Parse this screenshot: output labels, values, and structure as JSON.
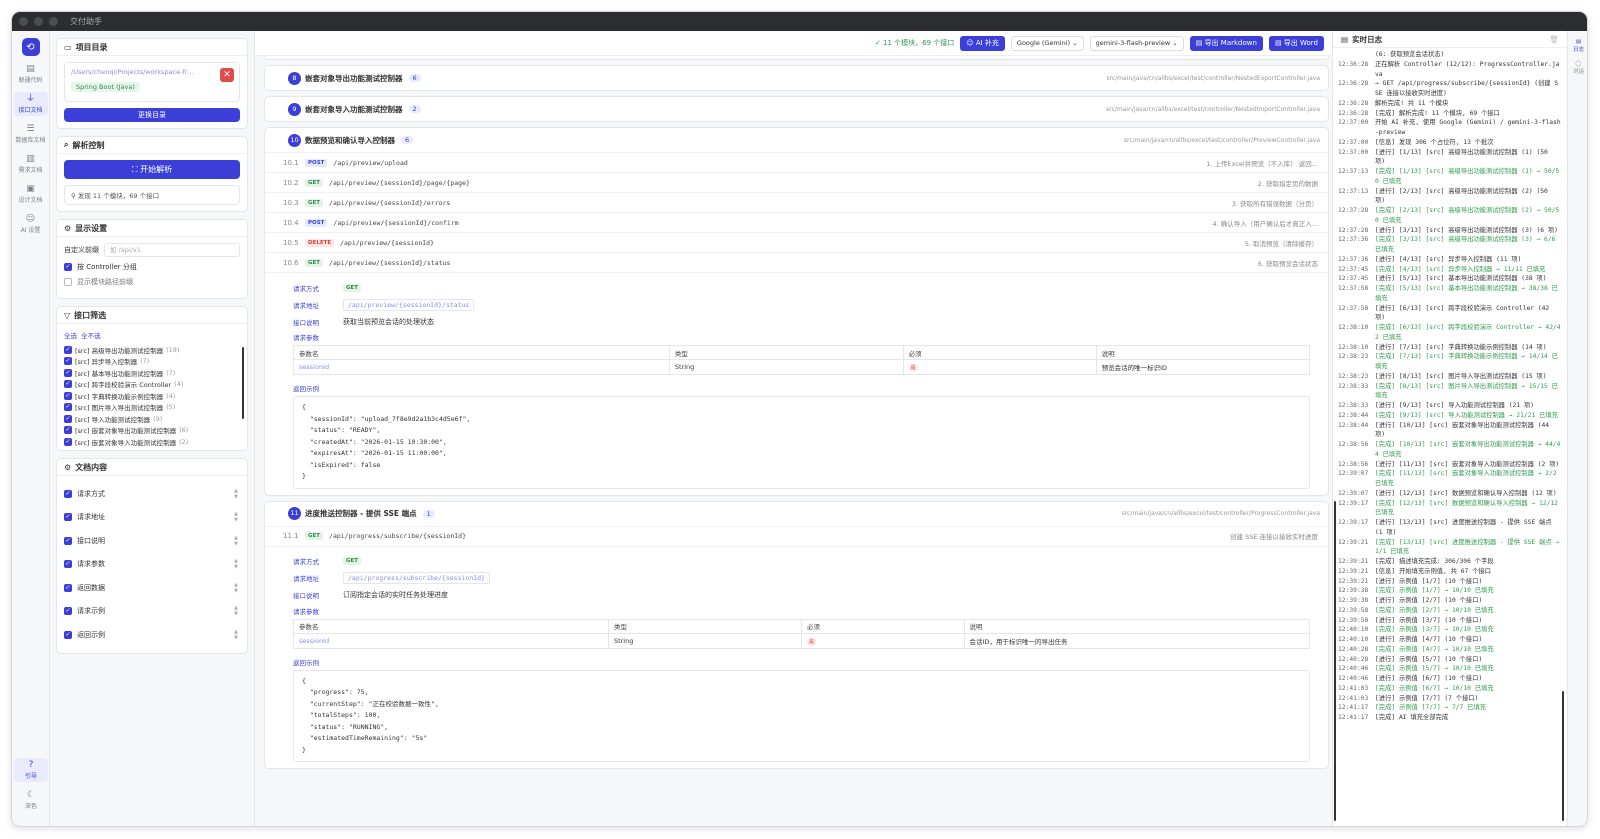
{
  "window": {
    "title": "交付助手"
  },
  "rail": {
    "items": [
      {
        "label": "联通代码",
        "icon": "code-file-icon"
      },
      {
        "label": "接口文档",
        "icon": "plug-icon",
        "active": true
      },
      {
        "label": "数据库文档",
        "icon": "database-icon"
      },
      {
        "label": "需求文档",
        "icon": "book-icon"
      },
      {
        "label": "设计文档",
        "icon": "doc-icon"
      },
      {
        "label": "AI 设置",
        "icon": "robot-icon"
      }
    ],
    "help": "引导",
    "theme": "深色"
  },
  "project": {
    "title": "项目目录",
    "path": "/Users/chenqi/Projects/workspace-fr…",
    "framework": "Spring Boot (Java)",
    "change_btn": "更换目录"
  },
  "parse": {
    "title": "解析控制",
    "start_btn": "开始解析",
    "summary": "发现 11 个模块，69 个接口"
  },
  "display": {
    "title": "显示设置",
    "prefix_label": "自定义前缀",
    "prefix_placeholder": "如 /api/v1",
    "group_by_controller": "按 Controller 分组",
    "show_module_prefix": "显示模块路径前缀"
  },
  "filter": {
    "title": "接口筛选",
    "select_all": "全选",
    "select_none": "全不选",
    "items": [
      {
        "label": "[src] 高级导出功能测试控制器",
        "n": "(18)"
      },
      {
        "label": "[src] 异步导入控制器",
        "n": "(7)"
      },
      {
        "label": "[src] 基本导出功能测试控制器",
        "n": "(7)"
      },
      {
        "label": "[src] 跨字段校验演示 Controller",
        "n": "(4)"
      },
      {
        "label": "[src] 字典转换功能示例控制器",
        "n": "(4)"
      },
      {
        "label": "[src] 图片导入导出测试控制器",
        "n": "(5)"
      },
      {
        "label": "[src] 导入功能测试控制器",
        "n": "(9)"
      },
      {
        "label": "[src] 嵌套对象导出功能测试控制器",
        "n": "(6)"
      },
      {
        "label": "[src] 嵌套对象导入功能测试控制器",
        "n": "(2)"
      }
    ]
  },
  "doc_content": {
    "title": "文档内容",
    "items": [
      "请求方式",
      "请求地址",
      "接口说明",
      "请求参数",
      "返回数据",
      "请求示例",
      "返回示例"
    ]
  },
  "toolbar": {
    "status": "✓ 11 个模块，69 个接口",
    "ai_btn": "AI 补充",
    "provider": "Google (Gemini)",
    "model": "gemini-3-flash-preview",
    "export_md": "导出 Markdown",
    "export_word": "导出 Word"
  },
  "groups": [
    {
      "num": "8",
      "title": "嵌套对象导出功能测试控制器",
      "count": "6",
      "path": "src/main/java/cn/allbs/excel/test/controller/NestedExportController.java"
    },
    {
      "num": "9",
      "title": "嵌套对象导入功能测试控制器",
      "count": "2",
      "path": "src/main/java/cn/allbs/excel/test/controller/NestedImportController.java"
    },
    {
      "num": "10",
      "title": "数据预览和确认导入控制器",
      "count": "6",
      "path": "src/main/java/cn/allbs/excel/test/controller/PreviewController.java",
      "endpoints": [
        {
          "no": "10.1",
          "method": "POST",
          "url": "/api/preview/upload",
          "desc": "1. 上传Excel并预览（不入库） 返回..."
        },
        {
          "no": "10.2",
          "method": "GET",
          "url": "/api/preview/{sessionId}/page/{page}",
          "desc": "2. 获取指定页的数据"
        },
        {
          "no": "10.3",
          "method": "GET",
          "url": "/api/preview/{sessionId}/errors",
          "desc": "3. 获取所有错误数据（分页）"
        },
        {
          "no": "10.4",
          "method": "POST",
          "url": "/api/preview/{sessionId}/confirm",
          "desc": "4. 确认导入（用户确认后才真正入..."
        },
        {
          "no": "10.5",
          "method": "DELETE",
          "url": "/api/preview/{sessionId}",
          "desc": "5. 取消预览（清除缓存）"
        },
        {
          "no": "10.6",
          "method": "GET",
          "url": "/api/preview/{sessionId}/status",
          "desc": "6. 获取预览会话状态"
        }
      ],
      "detail": {
        "method_label": "请求方式",
        "method": "GET",
        "url_label": "请求地址",
        "url": "/api/preview/{sessionId}/status",
        "desc_label": "接口说明",
        "desc": "获取当前预览会话的处理状态",
        "params_label": "请求参数",
        "cols": [
          "参数名",
          "类型",
          "必须",
          "说明"
        ],
        "params": [
          {
            "name": "sessionId",
            "type": "String",
            "req": "是",
            "desc": "预览会话的唯一标识ID"
          }
        ],
        "return_label": "返回示例",
        "code": "{\n  \"sessionId\": \"upload_7f8e9d2a1b3c4d5e6f\",\n  \"status\": \"READY\",\n  \"createdAt\": \"2026-01-15 10:30:00\",\n  \"expiresAt\": \"2026-01-15 11:00:00\",\n  \"isExpired\": false\n}"
      }
    },
    {
      "num": "11",
      "title": "进度推送控制器 - 提供 SSE 端点",
      "count": "1",
      "path": "src/main/java/cn/allbs/excel/test/controller/ProgressController.java",
      "endpoints": [
        {
          "no": "11.1",
          "method": "GET",
          "url": "/api/progress/subscribe/{sessionId}",
          "desc": "创建 SSE 连接以接收实时进度"
        }
      ],
      "detail": {
        "method_label": "请求方式",
        "method": "GET",
        "url_label": "请求地址",
        "url": "/api/progress/subscribe/{sessionId}",
        "desc_label": "接口说明",
        "desc": "订阅指定会话的实时任务处理进度",
        "params_label": "请求参数",
        "cols": [
          "参数名",
          "类型",
          "必须",
          "说明"
        ],
        "params": [
          {
            "name": "sessionId",
            "type": "String",
            "req": "是",
            "desc": "会话ID，用于标识唯一的导出任务"
          }
        ],
        "return_label": "返回示例",
        "code": "{\n  \"progress\": 75,\n  \"currentStep\": \"正在校验数据一致性\",\n  \"totalSteps\": 100,\n  \"status\": \"RUNNING\",\n  \"estimatedTimeRemaining\": \"5s\"\n}"
      }
    }
  ],
  "log": {
    "title": "实时日志",
    "lines": [
      {
        "t": "",
        "x": "(6: 获取预览会话状态)",
        "g": 0
      },
      {
        "t": "12:36:28",
        "x": "正在解析 Controller (12/12): ProgressController.java",
        "g": 0
      },
      {
        "t": "12:36:28",
        "x": "→ GET /api/progress/subscribe/{sessionId} (创建 SSE 连接以接收实时进度)",
        "g": 0
      },
      {
        "t": "12:36:28",
        "x": "解析完成! 共 11 个模块",
        "g": 0
      },
      {
        "t": "12:36:28",
        "x": "[完成] 解析完成! 11 个模块, 69 个接口",
        "g": 0
      },
      {
        "t": "12:37:00",
        "x": "开始 AI 补充, 使用 Google (Gemini) / gemini-3-flash-preview",
        "g": 0
      },
      {
        "t": "12:37:00",
        "x": "[信息] 发现 306 个占位符, 13 个批次",
        "g": 0
      },
      {
        "t": "12:37:00",
        "x": "[进行] [1/13] [src] 高级导出功能测试控制器 (1) (50 项)",
        "g": 0
      },
      {
        "t": "12:37:13",
        "x": "[完成] [1/13] [src] 高级导出功能测试控制器 (1) → 50/50 已填充",
        "g": 1
      },
      {
        "t": "12:37:13",
        "x": "[进行] [2/13] [src] 高级导出功能测试控制器 (2) (50 项)",
        "g": 0
      },
      {
        "t": "12:37:28",
        "x": "[完成] [2/13] [src] 高级导出功能测试控制器 (2) → 50/50 已填充",
        "g": 1
      },
      {
        "t": "12:37:28",
        "x": "[进行] [3/13] [src] 高级导出功能测试控制器 (3) (6 项)",
        "g": 0
      },
      {
        "t": "12:37:36",
        "x": "[完成] [3/13] [src] 高级导出功能测试控制器 (3) → 6/6 已填充",
        "g": 1
      },
      {
        "t": "12:37:36",
        "x": "[进行] [4/13] [src] 异步导入控制器 (11 项)",
        "g": 0
      },
      {
        "t": "12:37:45",
        "x": "[完成] [4/13] [src] 异步导入控制器 → 11/11 已填充",
        "g": 1
      },
      {
        "t": "12:37:45",
        "x": "[进行] [5/13] [src] 基本导出功能测试控制器 (38 项)",
        "g": 0
      },
      {
        "t": "12:37:58",
        "x": "[完成] [5/13] [src] 基本导出功能测试控制器 → 38/38 已填充",
        "g": 1
      },
      {
        "t": "12:37:58",
        "x": "[进行] [6/13] [src] 跨字段校验演示 Controller (42 项)",
        "g": 0
      },
      {
        "t": "12:38:10",
        "x": "[完成] [6/13] [src] 跨字段校验演示 Controller → 42/42 已填充",
        "g": 1
      },
      {
        "t": "12:38:10",
        "x": "[进行] [7/13] [src] 字典转换功能示例控制器 (14 项)",
        "g": 0
      },
      {
        "t": "12:38:23",
        "x": "[完成] [7/13] [src] 字典转换功能示例控制器 → 14/14 已填充",
        "g": 1
      },
      {
        "t": "12:38:23",
        "x": "[进行] [8/13] [src] 图片导入导出测试控制器 (15 项)",
        "g": 0
      },
      {
        "t": "12:38:33",
        "x": "[完成] [8/13] [src] 图片导入导出测试控制器 → 15/15 已填充",
        "g": 1
      },
      {
        "t": "12:38:33",
        "x": "[进行] [9/13] [src] 导入功能测试控制器 (21 项)",
        "g": 0
      },
      {
        "t": "12:38:44",
        "x": "[完成] [9/13] [src] 导入功能测试控制器 → 21/21 已填充",
        "g": 1
      },
      {
        "t": "12:38:44",
        "x": "[进行] [10/13] [src] 嵌套对象导出功能测试控制器 (44 项)",
        "g": 0
      },
      {
        "t": "12:38:56",
        "x": "[完成] [10/13] [src] 嵌套对象导出功能测试控制器 → 44/44 已填充",
        "g": 1
      },
      {
        "t": "12:38:56",
        "x": "[进行] [11/13] [src] 嵌套对象导入功能测试控制器 (2 项)",
        "g": 0
      },
      {
        "t": "12:39:07",
        "x": "[完成] [11/13] [src] 嵌套对象导入功能测试控制器 → 2/2 已填充",
        "g": 1
      },
      {
        "t": "12:39:07",
        "x": "[进行] [12/13] [src] 数据预览和确认导入控制器 (12 项)",
        "g": 0
      },
      {
        "t": "12:39:17",
        "x": "[完成] [12/13] [src] 数据预览和确认导入控制器 → 12/12 已填充",
        "g": 1
      },
      {
        "t": "12:39:17",
        "x": "[进行] [13/13] [src] 进度推送控制器 - 提供 SSE 端点 (1 项)",
        "g": 0
      },
      {
        "t": "12:39:21",
        "x": "[完成] [13/13] [src] 进度推送控制器 - 提供 SSE 端点 → 1/1 已填充",
        "g": 1
      },
      {
        "t": "12:39:21",
        "x": "[完成] 描述填充完成: 306/306 个字段",
        "g": 0
      },
      {
        "t": "12:39:21",
        "x": "[信息] 开始填充示例值, 共 67 个接口",
        "g": 0
      },
      {
        "t": "12:39:21",
        "x": "[进行] 示例值 [1/7] (10 个接口)",
        "g": 0
      },
      {
        "t": "12:39:38",
        "x": "[完成] 示例值 [1/7] → 10/10 已填充",
        "g": 1
      },
      {
        "t": "12:39:38",
        "x": "[进行] 示例值 [2/7] (10 个接口)",
        "g": 0
      },
      {
        "t": "12:39:58",
        "x": "[完成] 示例值 [2/7] → 10/10 已填充",
        "g": 1
      },
      {
        "t": "12:39:58",
        "x": "[进行] 示例值 [3/7] (10 个接口)",
        "g": 0
      },
      {
        "t": "12:40:10",
        "x": "[完成] 示例值 [3/7] → 10/10 已填充",
        "g": 1
      },
      {
        "t": "12:40:10",
        "x": "[进行] 示例值 [4/7] (10 个接口)",
        "g": 0
      },
      {
        "t": "12:40:28",
        "x": "[完成] 示例值 [4/7] → 10/10 已填充",
        "g": 1
      },
      {
        "t": "12:40:28",
        "x": "[进行] 示例值 [5/7] (10 个接口)",
        "g": 0
      },
      {
        "t": "12:40:46",
        "x": "[完成] 示例值 [5/7] → 10/10 已填充",
        "g": 1
      },
      {
        "t": "12:40:46",
        "x": "[进行] 示例值 [6/7] (10 个接口)",
        "g": 0
      },
      {
        "t": "12:41:03",
        "x": "[完成] 示例值 [6/7] → 10/10 已填充",
        "g": 1
      },
      {
        "t": "12:41:03",
        "x": "[进行] 示例值 [7/7] (7 个接口)",
        "g": 0
      },
      {
        "t": "12:41:17",
        "x": "[完成] 示例值 [7/7] → 7/7 已填充",
        "g": 1
      },
      {
        "t": "12:41:17",
        "x": "[完成] AI 填充全部完成",
        "g": 0
      }
    ]
  },
  "right_rail": {
    "items": [
      {
        "label": "日志",
        "active": true
      },
      {
        "label": "对话",
        "active": false
      }
    ]
  }
}
